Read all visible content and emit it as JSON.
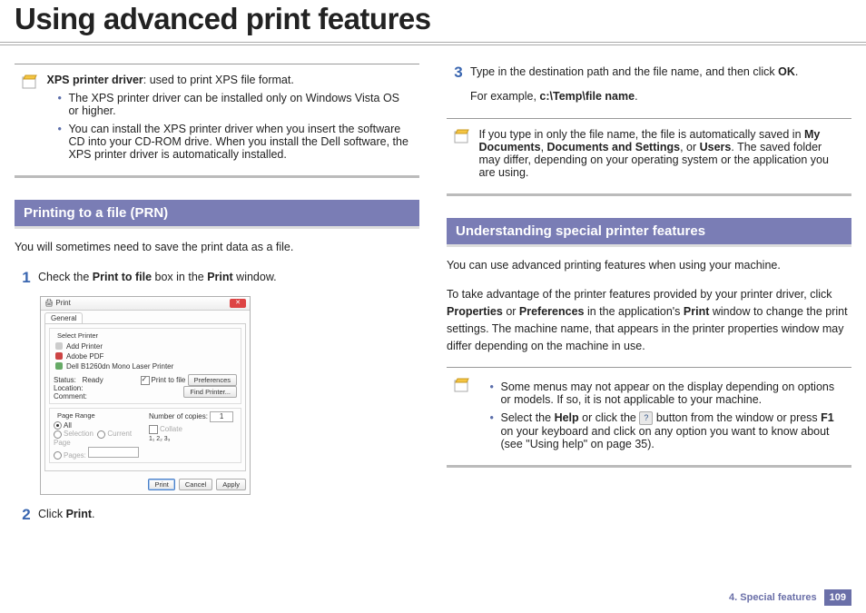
{
  "title": "Using advanced print features",
  "left": {
    "note1": {
      "lead_bold": "XPS printer driver",
      "lead_rest": ": used to print XPS file format.",
      "bullets": [
        "The XPS printer driver can be installed only on Windows Vista OS or higher.",
        "You can install the XPS printer driver when you insert the software CD into your CD-ROM drive. When you install the Dell software, the XPS printer driver is automatically installed."
      ]
    },
    "section": "Printing to a file (PRN)",
    "intro": "You will sometimes need to save the print data as a file.",
    "step1_pre": "Check the ",
    "step1_b1": "Print to file",
    "step1_mid": " box in the ",
    "step1_b2": "Print",
    "step1_post": " window.",
    "step2_pre": "Click ",
    "step2_b": "Print",
    "step2_post": ".",
    "shot": {
      "title": "Print",
      "tab": "General",
      "group_printer": "Select Printer",
      "printers": [
        "Add Printer",
        "Adobe PDF",
        "Dell B1260dn Mono Laser Printer"
      ],
      "status_lbl": "Status:",
      "status": "Ready",
      "loc_lbl": "Location:",
      "comment_lbl": "Comment:",
      "ptf": "Print to file",
      "prefs": "Preferences",
      "find": "Find Printer...",
      "group_range": "Page Range",
      "all": "All",
      "sel": "Selection",
      "cur": "Current Page",
      "pages": "Pages:",
      "copies_lbl": "Number of copies:",
      "copies": "1",
      "collate": "Collate",
      "b_print": "Print",
      "b_cancel": "Cancel",
      "b_apply": "Apply"
    }
  },
  "right": {
    "step3_pre": "Type in the destination path and the file name, and then click ",
    "step3_b": "OK",
    "step3_post": ".",
    "step3_ex_pre": "For example, ",
    "step3_ex_b": "c:\\Temp\\file name",
    "step3_ex_post": ".",
    "note2_pre": "If you type in only the file name, the file is automatically saved in ",
    "note2_b1": "My Documents",
    "note2_m1": ", ",
    "note2_b2": "Documents and Settings",
    "note2_m2": ", or ",
    "note2_b3": "Users",
    "note2_post": ". The saved folder may differ, depending on your operating system or the application you are using.",
    "section": "Understanding special printer features",
    "para1": "You can use advanced printing features when using your machine.",
    "para2_pre": "To take advantage of the printer features provided by your printer driver, click ",
    "para2_b1": "Properties",
    "para2_m1": " or ",
    "para2_b2": "Preferences",
    "para2_m2": " in the application's ",
    "para2_b3": "Print",
    "para2_post": " window to change the print settings. The machine name, that appears in the printer properties window may differ depending on the machine in use.",
    "note3_b1": "Some menus may not appear on the display depending on options or models. If so, it is not applicable to your machine.",
    "note3_pre": "Select the ",
    "note3_b_help": "Help",
    "note3_m1": " or click the ",
    "note3_m2": " button from the window or press ",
    "note3_b_f1": "F1",
    "note3_post": " on your keyboard and click on any option you want to know about (see \"Using help\" on page 35)."
  },
  "footer": {
    "chapter": "4.  Special features",
    "page": "109"
  }
}
